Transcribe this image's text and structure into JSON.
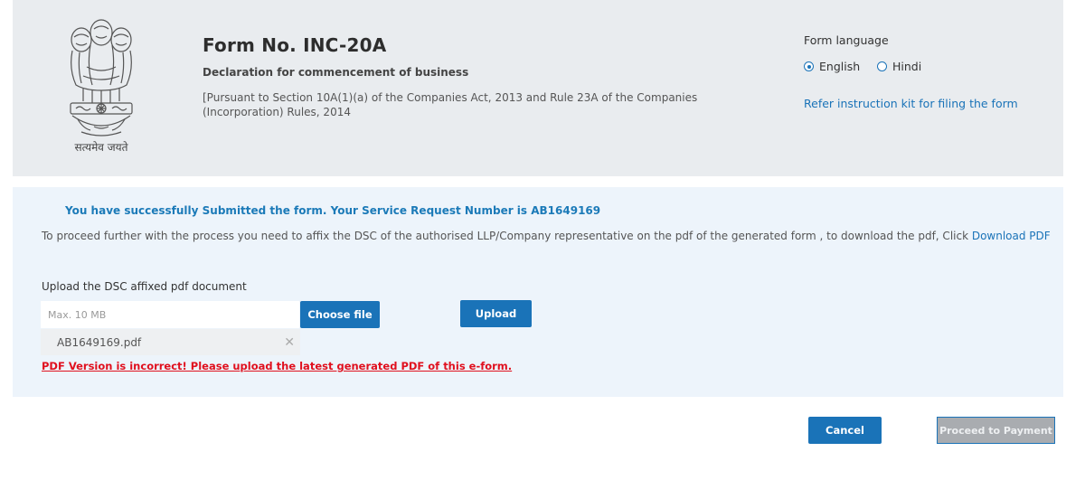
{
  "header": {
    "emblem_motto": "सत्यमेव जयते",
    "form_title": "Form No. INC-20A",
    "form_subtitle": "Declaration for commencement of business",
    "pursuant_text": "[Pursuant to Section 10A(1)(a) of the Companies Act, 2013 and Rule 23A of the Companies (Incorporation) Rules, 2014",
    "language": {
      "label": "Form language",
      "options": [
        {
          "label": "English",
          "selected": true
        },
        {
          "label": "Hindi",
          "selected": false
        }
      ]
    },
    "instruction_link": "Refer instruction kit for filing the form"
  },
  "panel": {
    "success_message": "You have successfully Submitted the form. Your Service Request Number is AB1649169",
    "proceed_text": "To proceed further with the process you need to affix the DSC of the authorised LLP/Company representative on the pdf of the generated form , to download the pdf, Click ",
    "download_link": "Download PDF",
    "upload_label": "Upload the DSC affixed pdf document",
    "file_input_placeholder": "Max. 10 MB",
    "choose_file_label": "Choose file",
    "upload_label_btn": "Upload",
    "selected_file": "AB1649169.pdf",
    "error_message": "PDF Version is incorrect! Please upload the latest generated PDF of this e-form."
  },
  "footer": {
    "cancel_label": "Cancel",
    "payment_label": "Proceed to Payment"
  },
  "colors": {
    "accent": "#1a73b8",
    "error": "#e0101e",
    "header_bg": "#e9ecef",
    "panel_bg": "#edf4fb",
    "disabled_btn": "#a9acb0"
  },
  "icons": {
    "emblem": "national-emblem-icon",
    "remove_file": "close-icon"
  }
}
